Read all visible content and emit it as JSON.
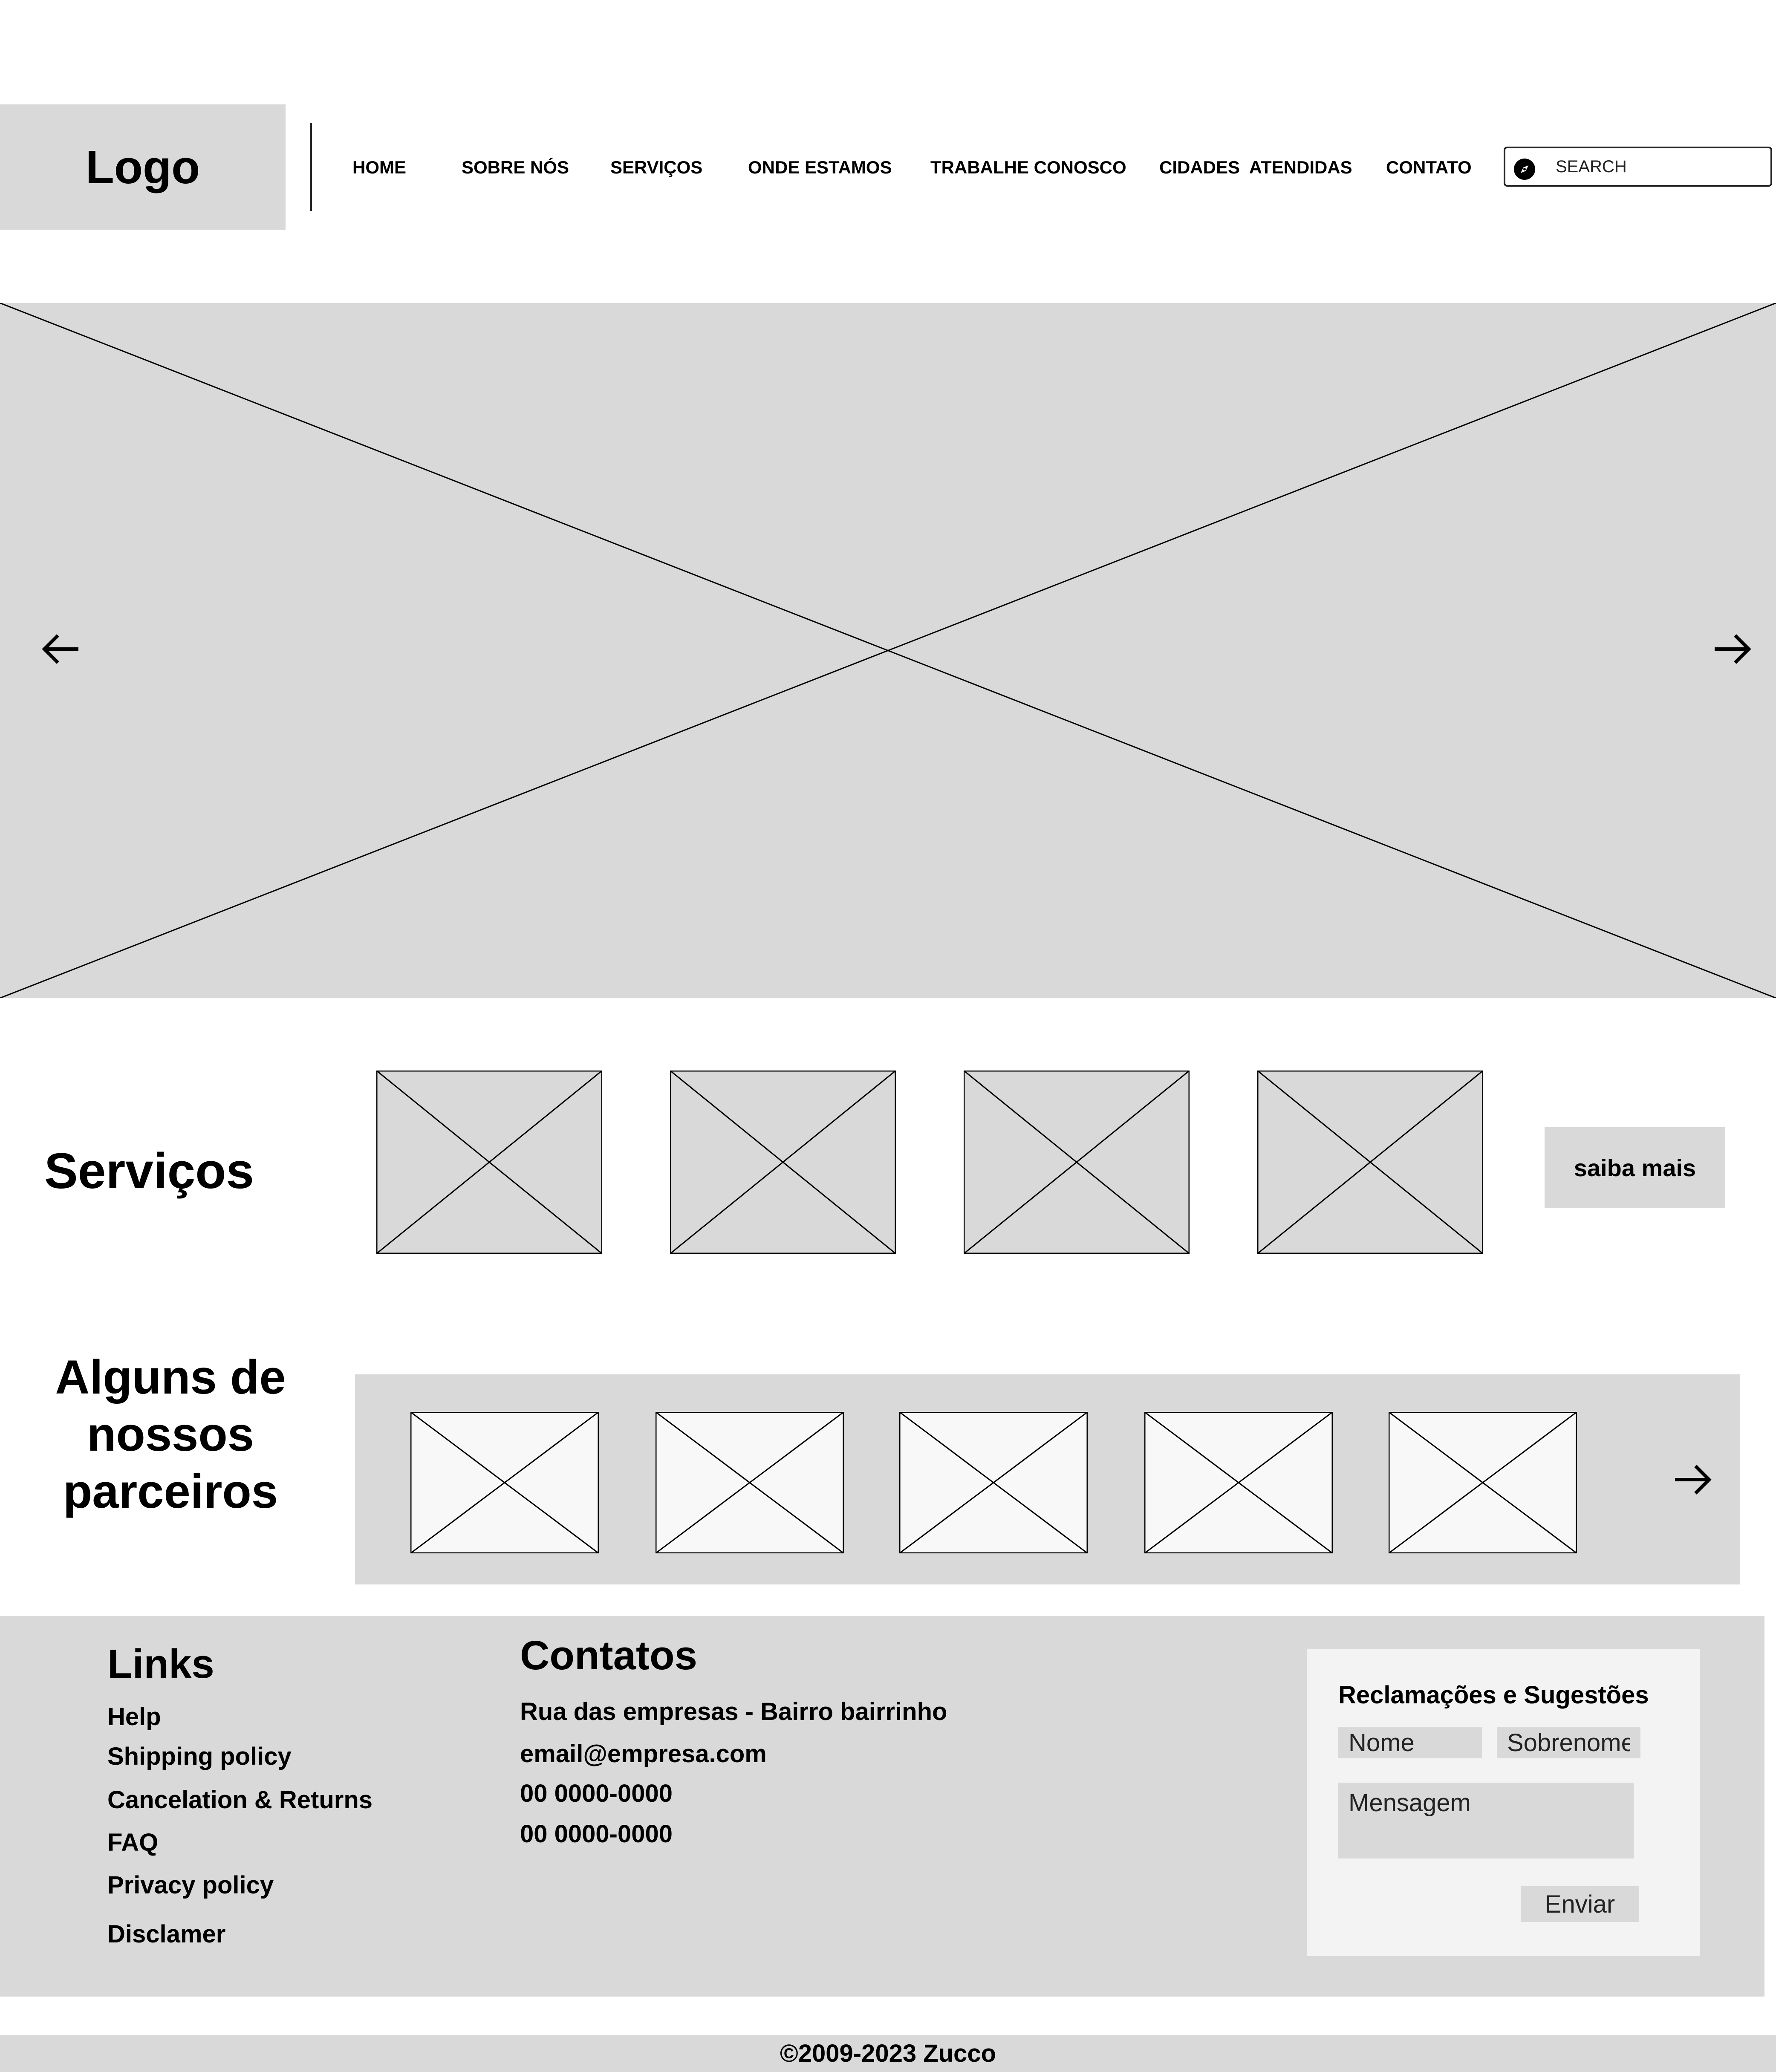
{
  "header": {
    "logo": "Logo",
    "nav": [
      "HOME",
      "SOBRE NÓS",
      "SERVIÇOS",
      "ONDE ESTAMOS",
      "TRABALHE CONOSCO",
      "CIDADES  ATENDIDAS",
      "CONTATO"
    ],
    "search_placeholder": "SEARCH",
    "search_icon": "compass-icon"
  },
  "hero": {
    "prev_icon": "arrow-left-icon",
    "next_icon": "arrow-right-icon"
  },
  "services": {
    "title": "Serviços",
    "button": "saiba mais"
  },
  "partners": {
    "title": "Alguns de nossos parceiros",
    "next_icon": "arrow-right-icon"
  },
  "footer": {
    "links_title": "Links",
    "links": [
      "Help",
      "Shipping policy",
      "Cancelation & Returns",
      "FAQ",
      "Privacy policy",
      "Disclamer"
    ],
    "contacts_title": "Contatos",
    "contacts": [
      "Rua das empresas - Bairro bairrinho",
      "email@empresa.com",
      "00 0000-0000",
      "00 0000-0000"
    ],
    "feedback": {
      "title": "Reclamações e Sugestões",
      "first_name_placeholder": "Nome",
      "last_name_placeholder": "Sobrenome",
      "message_placeholder": "Mensagem",
      "send": "Enviar"
    }
  },
  "copyright": "©2009-2023 Zucco",
  "colors": {
    "placeholder_gray": "#d9d9d9",
    "card_light": "#f3f3f3",
    "partner_tile": "#f8f8f8",
    "text": "#000000"
  }
}
